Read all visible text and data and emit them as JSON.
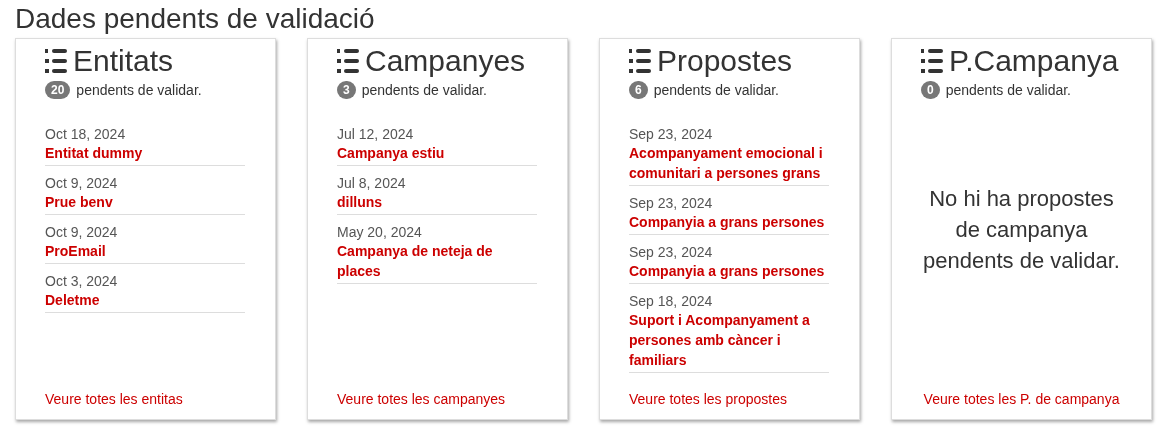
{
  "title": "Dades pendents de validació",
  "cards": [
    {
      "title": "Entitats",
      "count": "20",
      "count_label": "pendents de validar.",
      "items": [
        {
          "date": "Oct 18, 2024",
          "name": "Entitat dummy"
        },
        {
          "date": "Oct 9, 2024",
          "name": "Prue benv"
        },
        {
          "date": "Oct 9, 2024",
          "name": "ProEmail"
        },
        {
          "date": "Oct 3, 2024",
          "name": "Deletme"
        }
      ],
      "footer_link": "Veure totes les entitas"
    },
    {
      "title": "Campanyes",
      "count": "3",
      "count_label": "pendents de validar.",
      "items": [
        {
          "date": "Jul 12, 2024",
          "name": "Campanya estiu"
        },
        {
          "date": "Jul 8, 2024",
          "name": "dilluns"
        },
        {
          "date": "May 20, 2024",
          "name": "Campanya de neteja de places"
        }
      ],
      "footer_link": "Veure totes les campanyes"
    },
    {
      "title": "Propostes",
      "count": "6",
      "count_label": "pendents de validar.",
      "items": [
        {
          "date": "Sep 23, 2024",
          "name": "Acompanyament emocional i comunitari a persones grans"
        },
        {
          "date": "Sep 23, 2024",
          "name": "Companyia a grans persones"
        },
        {
          "date": "Sep 23, 2024",
          "name": "Companyia a grans persones"
        },
        {
          "date": "Sep 18, 2024",
          "name": "Suport i Acompanyament a persones amb càncer i familiars"
        }
      ],
      "footer_link": "Veure totes les propostes"
    },
    {
      "title": "P.Campanya",
      "count": "0",
      "count_label": "pendents de validar.",
      "empty_message": "No hi ha propostes de campanya pendents de validar.",
      "footer_link": "Veure totes les P. de campanya"
    }
  ]
}
